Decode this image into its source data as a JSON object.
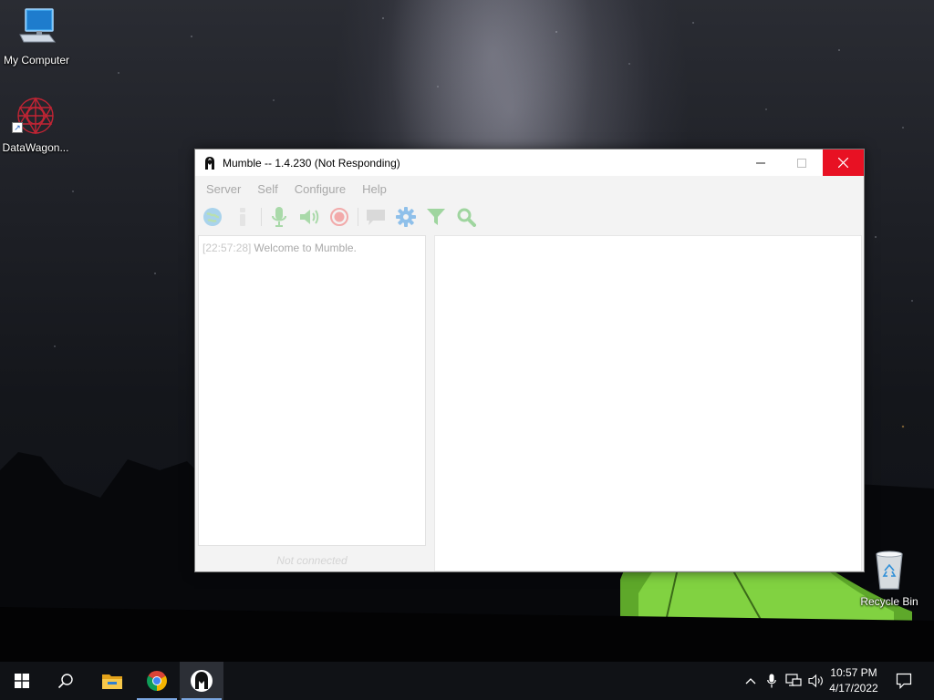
{
  "desktop": {
    "icons": [
      {
        "label": "My Computer",
        "icon": "computer-icon"
      },
      {
        "label": "DataWagon...",
        "icon": "datawagon-icon"
      },
      {
        "label": "Recycle Bin",
        "icon": "recycle-bin-icon"
      }
    ]
  },
  "window": {
    "title": "Mumble -- 1.4.230 (Not Responding)",
    "icon": "mumble-icon",
    "close_color": "#e81123",
    "menu": [
      "Server",
      "Self",
      "Configure",
      "Help"
    ],
    "toolbar": [
      {
        "icon": "globe-icon",
        "color": "#9ecbe6"
      },
      {
        "icon": "info-icon",
        "color": "#e2e2e2"
      },
      {
        "icon": "microphone-icon",
        "color": "#a8d8a8"
      },
      {
        "icon": "speaker-icon",
        "color": "#a8d8a8"
      },
      {
        "icon": "record-icon",
        "color": "#f2a9a9"
      },
      {
        "icon": "chat-icon",
        "color": "#d6d6d6"
      },
      {
        "icon": "gear-icon",
        "color": "#8fbfe8"
      },
      {
        "icon": "filter-icon",
        "color": "#9fd49f"
      },
      {
        "icon": "search-icon",
        "color": "#9fd49f"
      }
    ],
    "log": {
      "timestamp": "[22:57:28]",
      "message": "Welcome to Mumble."
    },
    "status": "Not connected"
  },
  "taskbar": {
    "apps": [
      {
        "icon": "start-icon"
      },
      {
        "icon": "search-icon"
      },
      {
        "icon": "file-explorer-icon"
      },
      {
        "icon": "chrome-icon"
      },
      {
        "icon": "mumble-icon"
      }
    ],
    "time": "10:57 PM",
    "date": "4/17/2022"
  }
}
